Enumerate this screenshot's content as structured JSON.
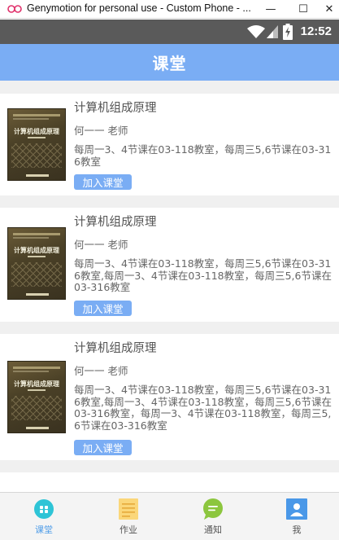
{
  "window": {
    "title": "Genymotion for personal use - Custom Phone - ...",
    "minimize": "—",
    "maximize": "☐",
    "close": "✕"
  },
  "statusbar": {
    "time": "12:52"
  },
  "header": {
    "title": "课堂"
  },
  "courses": [
    {
      "cover_title": "计算机组成原理",
      "title": "计算机组成原理",
      "teacher": "何一一 老师",
      "schedule": "每周一3、4节课在03-118教室，每周三5,6节课在03-316教室",
      "join_label": "加入课堂"
    },
    {
      "cover_title": "计算机组成原理",
      "title": "计算机组成原理",
      "teacher": "何一一 老师",
      "schedule": "每周一3、4节课在03-118教室，每周三5,6节课在03-316教室,每周一3、4节课在03-118教室，每周三5,6节课在03-316教室",
      "join_label": "加入课堂"
    },
    {
      "cover_title": "计算机组成原理",
      "title": "计算机组成原理",
      "teacher": "何一一 老师",
      "schedule": "每周一3、4节课在03-118教室，每周三5,6节课在03-316教室,每周一3、4节课在03-118教室，每周三5,6节课在03-316教室，每周一3、4节课在03-118教室，每周三5,6节课在03-316教室",
      "join_label": "加入课堂"
    }
  ],
  "bottom_nav": [
    {
      "label": "课堂",
      "icon": "classroom-icon",
      "active": true
    },
    {
      "label": "作业",
      "icon": "homework-icon",
      "active": false
    },
    {
      "label": "通知",
      "icon": "notification-icon",
      "active": false
    },
    {
      "label": "我",
      "icon": "profile-icon",
      "active": false
    }
  ],
  "colors": {
    "header": "#7aadf4",
    "statusbar": "#5a5a5a",
    "button": "#7aadf4",
    "active_tab": "#4f9de8"
  }
}
